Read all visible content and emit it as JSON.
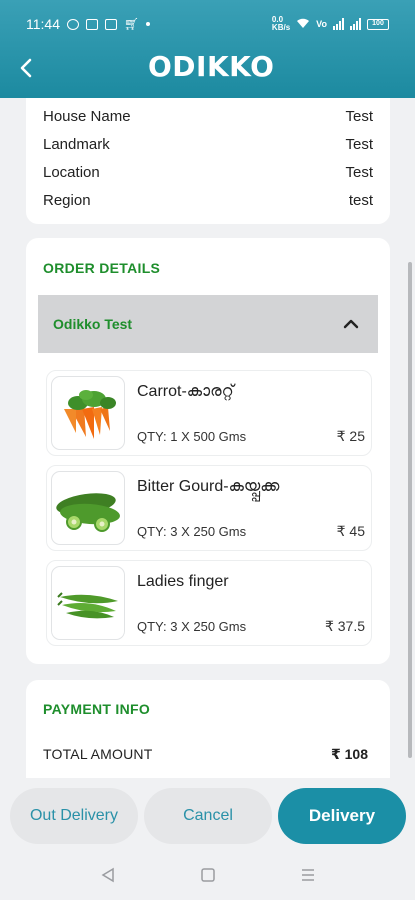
{
  "status_bar": {
    "time": "11:44",
    "battery": "100"
  },
  "header": {
    "logo_text": "ODIKKO",
    "back_icon": "back-chevron-icon",
    "brand_color": "#1c8aa0"
  },
  "address": {
    "rows": [
      {
        "label": "House Name",
        "value": "Test"
      },
      {
        "label": "Landmark",
        "value": "Test"
      },
      {
        "label": "Location",
        "value": "Test"
      },
      {
        "label": "Region",
        "value": "test"
      }
    ]
  },
  "order": {
    "section_title": "ORDER DETAILS",
    "accordion_title": "Odikko Test",
    "accent_color": "#1e8e2c",
    "items": [
      {
        "name": "Carrot-കാരറ്റ്",
        "qty": "QTY: 1 X 500 Gms",
        "price": "₹ 25",
        "icon": "carrot-image"
      },
      {
        "name": "Bitter Gourd-കയ്പ്പക്ക",
        "qty": "QTY: 3 X 250 Gms",
        "price": "₹ 45",
        "icon": "bitter-gourd-image"
      },
      {
        "name": "Ladies finger",
        "qty": "QTY: 3 X 250 Gms",
        "price": "₹ 37.5",
        "icon": "okra-image"
      }
    ]
  },
  "payment": {
    "section_title": "PAYMENT INFO",
    "total_label": "TOTAL AMOUNT",
    "total_value": "₹ 108"
  },
  "actions": {
    "out_delivery": "Out Delivery",
    "cancel": "Cancel",
    "delivery": "Delivery"
  }
}
